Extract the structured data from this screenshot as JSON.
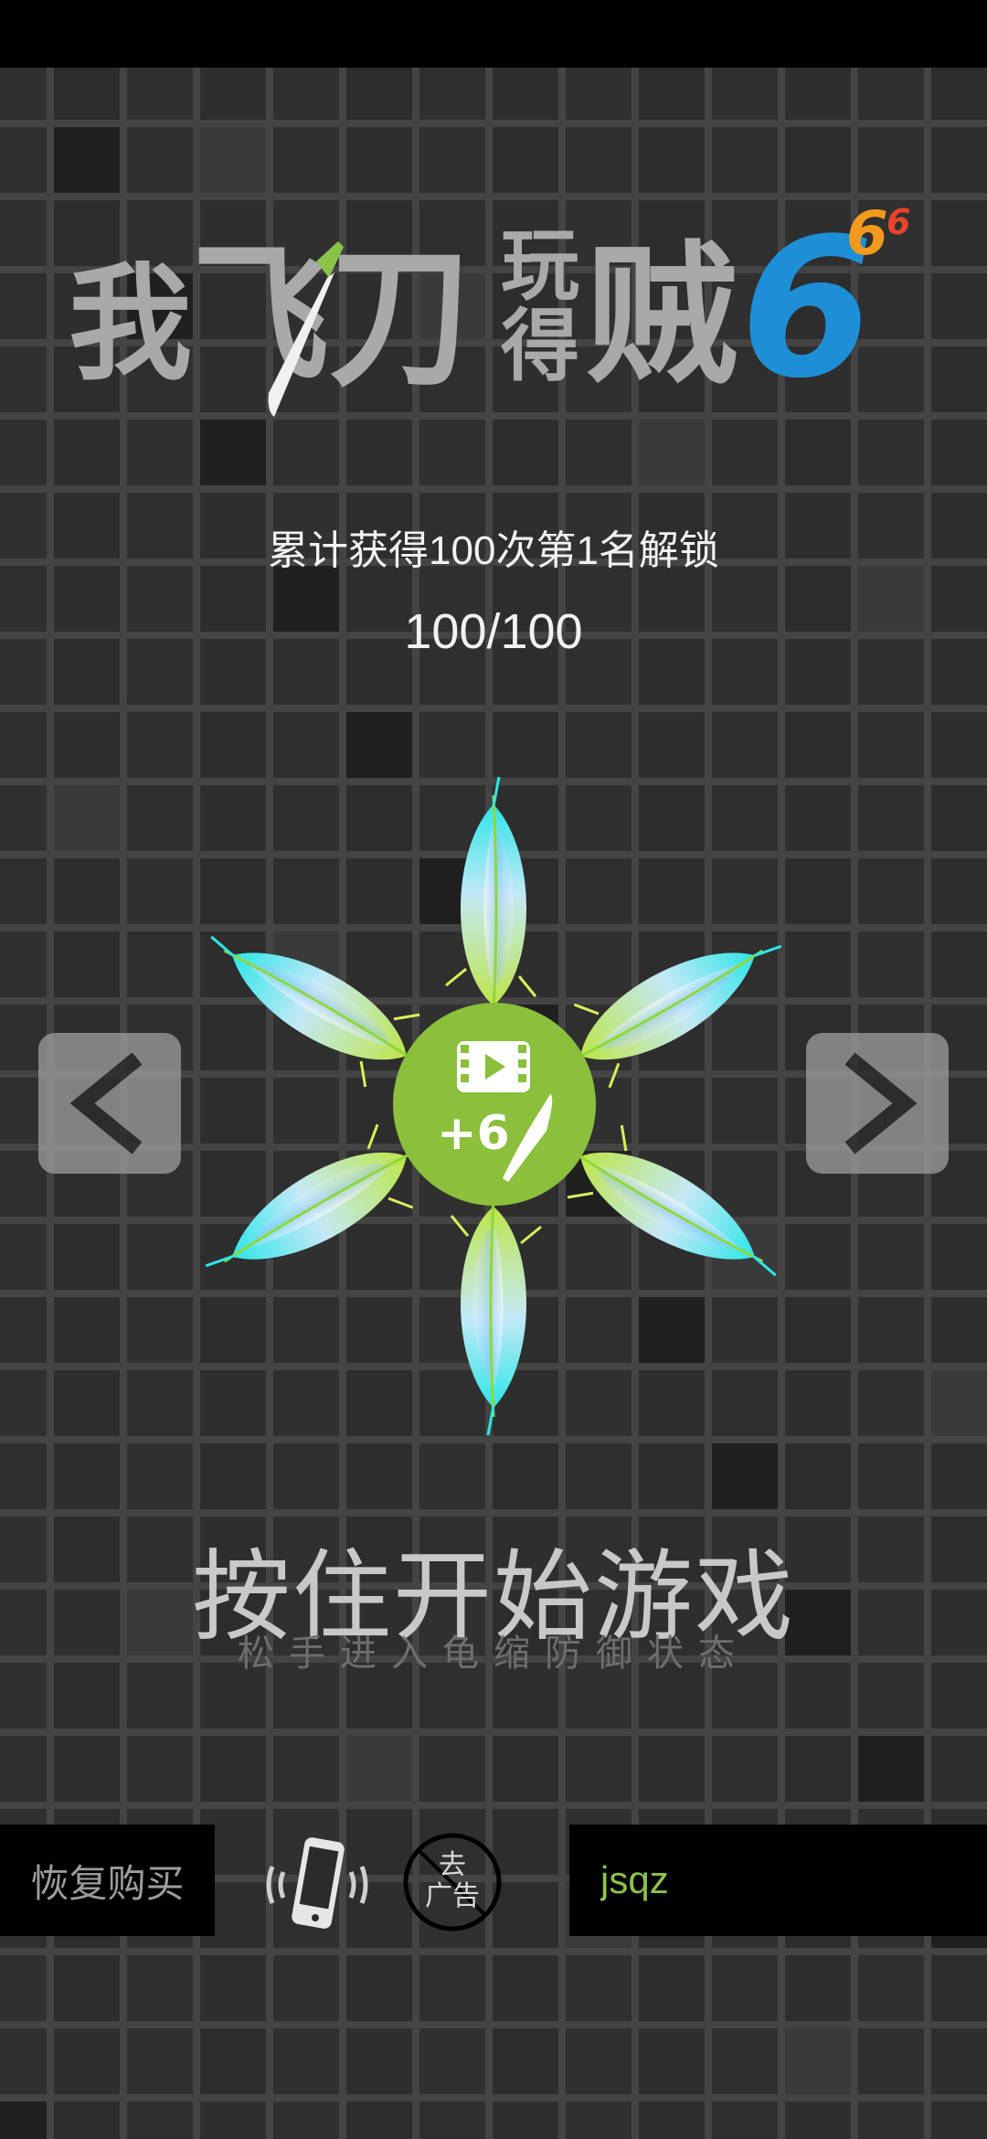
{
  "logo": {
    "title_chars": [
      "我",
      "飞",
      "刀",
      "玩",
      "得",
      "贼"
    ],
    "big_number": "6",
    "sup1": "6",
    "sup2": "6"
  },
  "unlock": {
    "condition": "累计获得100次第1名解锁",
    "progress": "100/100"
  },
  "ad_bonus": {
    "label": "+6"
  },
  "start": {
    "title": "按住开始游戏",
    "subtitle": "松手进入龟缩防御状态"
  },
  "bottom": {
    "restore_label": "恢复购买",
    "remove_ads_line1": "去",
    "remove_ads_line2": "广告",
    "code_value": "jsqz"
  },
  "icons": {
    "prev": "chevron-left-icon",
    "next": "chevron-right-icon",
    "vibrate": "vibrate-phone-icon",
    "video": "video-icon",
    "knife": "knife-icon"
  },
  "colors": {
    "background": "#2b2b2b",
    "accent_green": "#8bc34a",
    "logo_blue": "#1e8fd6",
    "logo_orange": "#f39a1e",
    "logo_red": "#e5442b"
  }
}
